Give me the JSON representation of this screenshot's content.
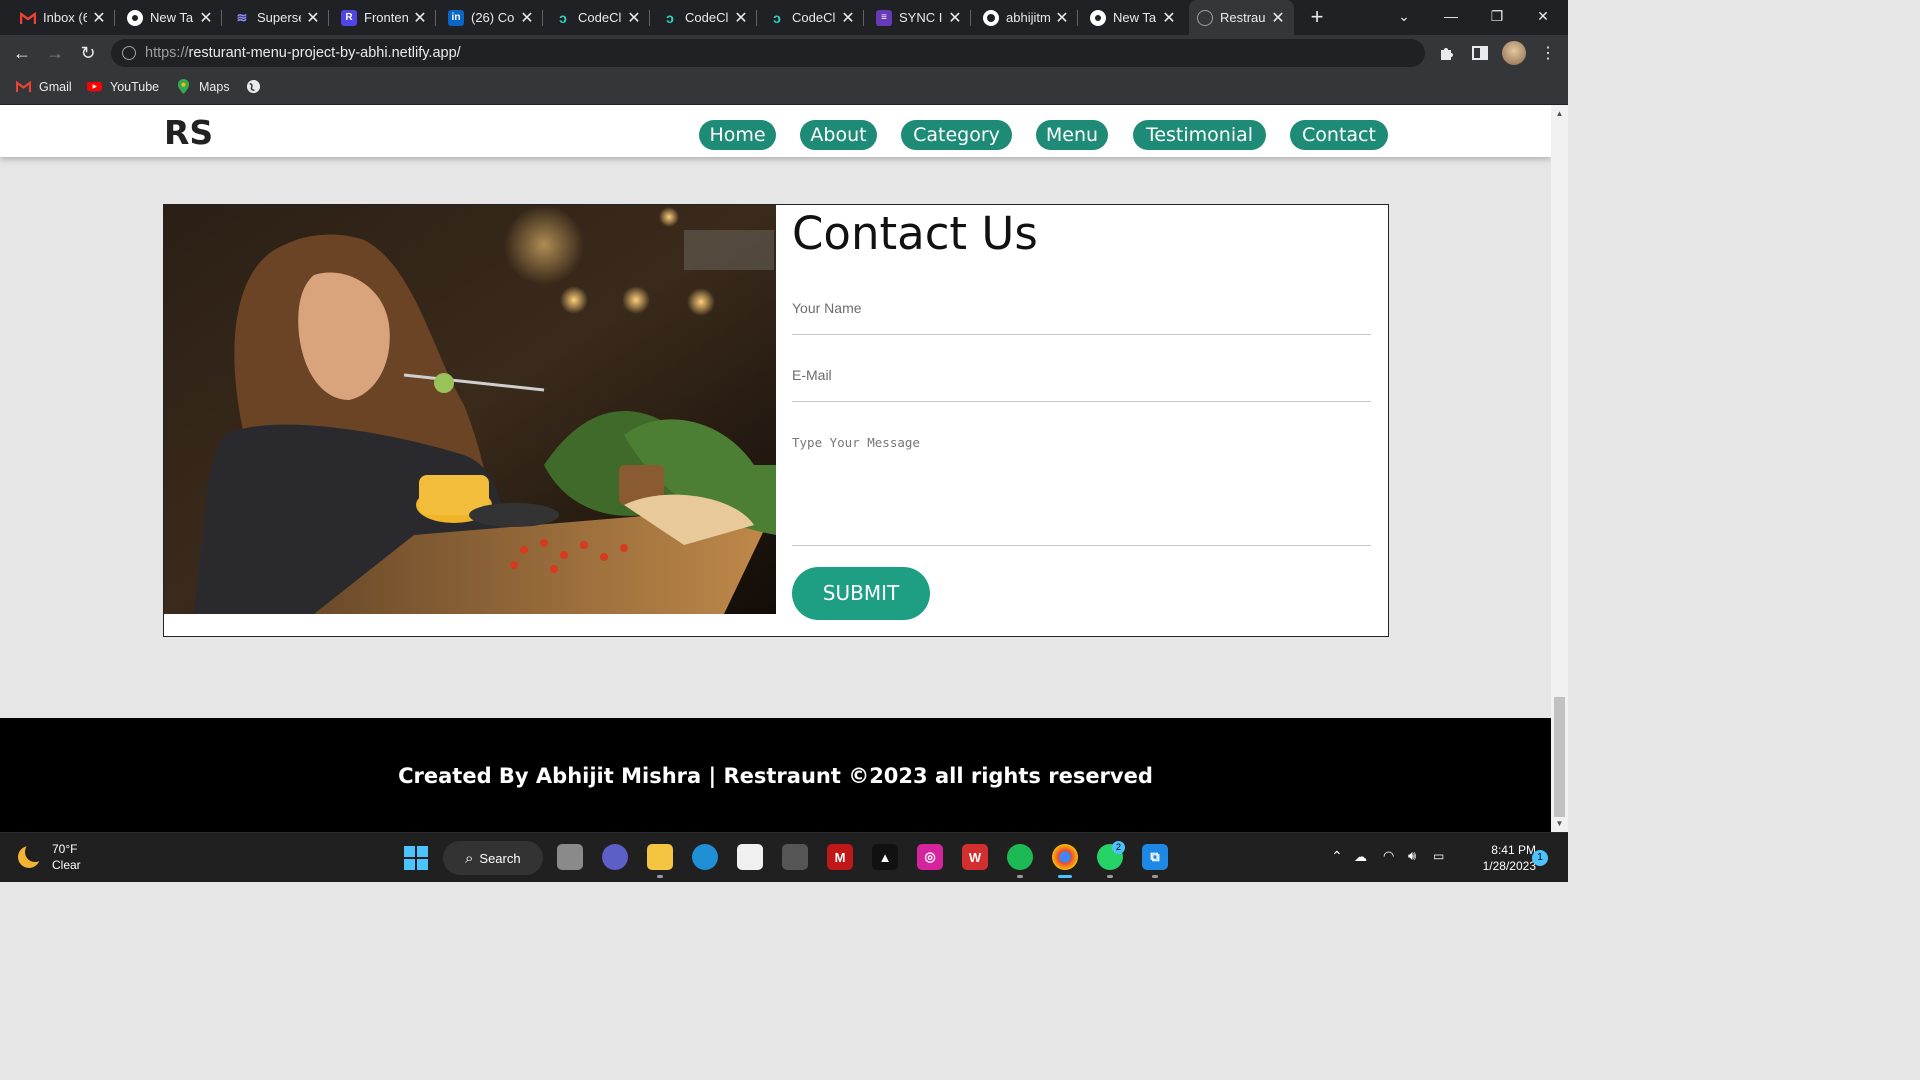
{
  "browser": {
    "tabs": [
      {
        "title": "Inbox (6",
        "icon": "gmail-icon",
        "color": "#ea4335"
      },
      {
        "title": "New Tal",
        "icon": "chrome-icon",
        "color": "#ffffff"
      },
      {
        "title": "Superse",
        "icon": "supersetgen-icon",
        "color": "#7c7cff"
      },
      {
        "title": "Fronten",
        "icon": "r-icon",
        "color": "#4f46e5"
      },
      {
        "title": "(26) Co",
        "icon": "linkedin-icon",
        "color": "#0a66c2"
      },
      {
        "title": "CodeCl",
        "icon": "codeclause-icon",
        "color": "#2dd4bf"
      },
      {
        "title": "CodeCl",
        "icon": "codeclause-icon",
        "color": "#2dd4bf"
      },
      {
        "title": "CodeCl",
        "icon": "codeclause-icon",
        "color": "#2dd4bf"
      },
      {
        "title": "SYNC In",
        "icon": "form-icon",
        "color": "#673ab7"
      },
      {
        "title": "abhijitm",
        "icon": "github-icon",
        "color": "#ffffff"
      },
      {
        "title": "New Ta",
        "icon": "chrome-icon",
        "color": "#ffffff"
      },
      {
        "title": "Restrau",
        "icon": "globe-icon",
        "color": "#9aa0a6"
      }
    ],
    "url_protocol": "https://",
    "url_host": "resturant-menu-project-by-abhi.netlify.app/",
    "bookmarks": [
      {
        "label": "Gmail",
        "icon": "gmail-icon"
      },
      {
        "label": "YouTube",
        "icon": "youtube-icon"
      },
      {
        "label": "Maps",
        "icon": "maps-icon"
      },
      {
        "label": "",
        "icon": "globe-icon"
      }
    ]
  },
  "site": {
    "logo": "RS",
    "nav": [
      "Home",
      "About",
      "Category",
      "Menu",
      "Testimonial",
      "Contact"
    ],
    "accent": "#1e8b76",
    "contact": {
      "title": "Contact Us",
      "name_placeholder": "Your Name",
      "email_placeholder": "E-Mail",
      "message_placeholder": "Type Your Message",
      "submit_label": "SUBMIT"
    },
    "footer": "Created By Abhijit Mishra | Restraunt ©2023 all rights reserved"
  },
  "taskbar": {
    "weather_temp": "70°F",
    "weather_desc": "Clear",
    "search_label": "Search",
    "time": "8:41 PM",
    "date": "1/28/2023",
    "notifications": "1",
    "whatsapp_badge": "2"
  }
}
